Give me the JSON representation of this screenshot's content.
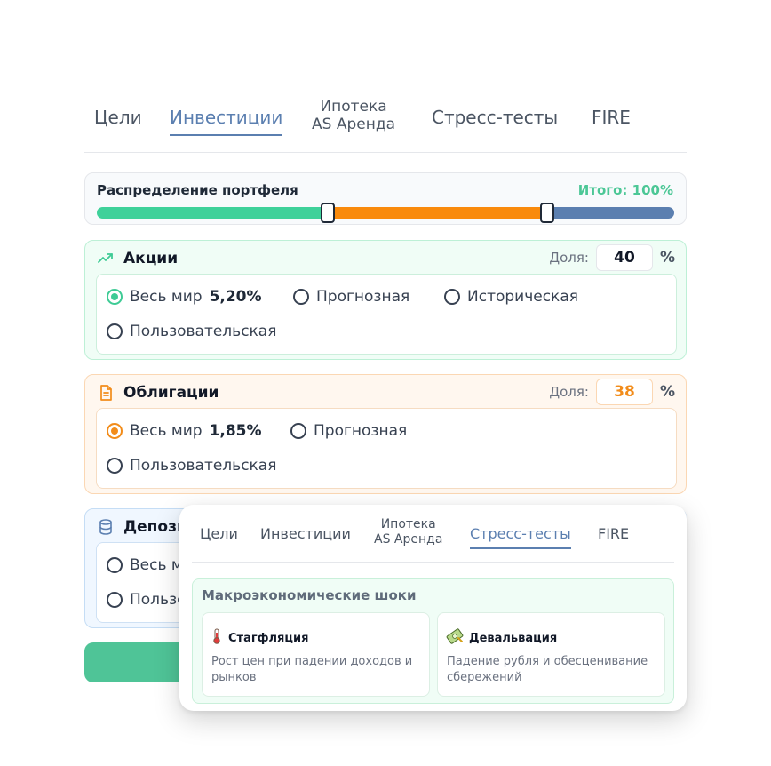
{
  "tabs": [
    {
      "label": "Цели"
    },
    {
      "label": "Инвестиции"
    },
    {
      "line1": "Ипотека",
      "line2": "AS Аренда"
    },
    {
      "label": "Стресс-тесты"
    },
    {
      "label": "FIRE"
    }
  ],
  "allocation": {
    "title": "Распределение портфеля",
    "total": "Итого: 100%",
    "segments": [
      {
        "name": "stocks",
        "percent": 40,
        "color": "#3fd19a"
      },
      {
        "name": "bonds",
        "percent": 38,
        "color": "#f98a0c"
      },
      {
        "name": "deposits",
        "percent": 22,
        "color": "#5b7fb0"
      }
    ]
  },
  "stocks": {
    "name": "Акции",
    "icon": "trending-up-icon",
    "share_label": "Доля:",
    "share_value": "40",
    "share_color": "#111827",
    "pct": "%",
    "opt_world": "Весь мир",
    "opt_world_rate": "5,20%",
    "opt_forecast": "Прогнозная",
    "opt_historical": "Историческая",
    "opt_custom": "Пользовательская"
  },
  "bonds": {
    "name": "Облигации",
    "icon": "document-icon",
    "share_label": "Доля:",
    "share_value": "38",
    "share_color": "#f28c1a",
    "pct": "%",
    "opt_world": "Весь мир",
    "opt_world_rate": "1,85%",
    "opt_forecast": "Прогнозная",
    "opt_custom": "Пользовательская"
  },
  "deposits": {
    "name": "Депози",
    "icon": "database-icon",
    "opt_world": "Весь м",
    "opt_custom": "Пользо"
  },
  "overlay": {
    "tabs": [
      {
        "label": "Цели"
      },
      {
        "label": "Инвестиции"
      },
      {
        "line1": "Ипотека",
        "line2": "AS Аренда"
      },
      {
        "label": "Стресс-тесты"
      },
      {
        "label": "FIRE"
      }
    ],
    "section_title": "Макроэкономические шоки",
    "scenarios": [
      {
        "name": "Стагфляция",
        "icon": "thermometer-icon",
        "description": "Рост цен при падении доходов и рынков"
      },
      {
        "name": "Девальвация",
        "icon": "banknote-icon",
        "description": "Падение рубля и обесценивание сбережений"
      }
    ]
  }
}
